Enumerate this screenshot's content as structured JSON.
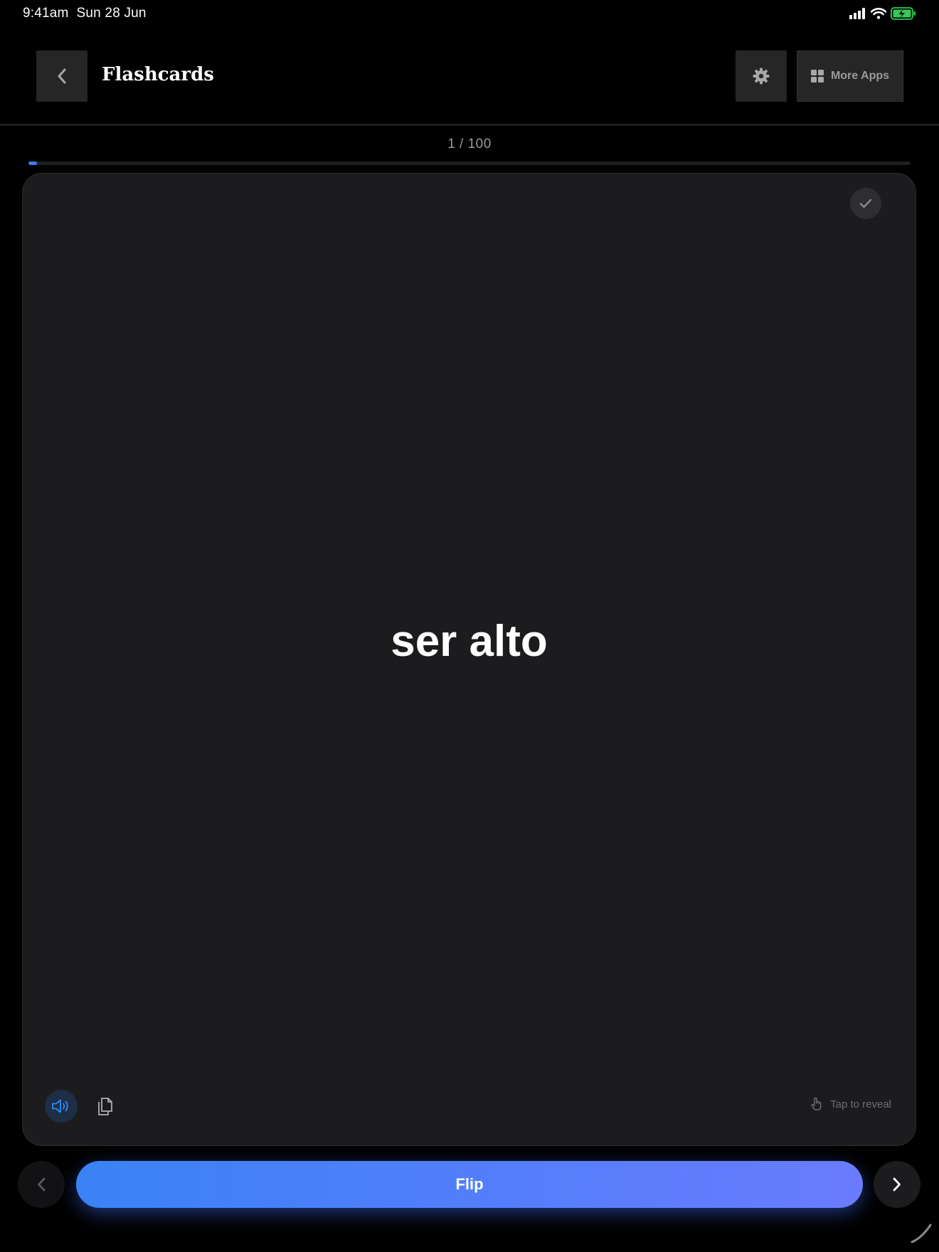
{
  "status_bar": {
    "time": "9:41am",
    "date": "Sun 28 Jun"
  },
  "header": {
    "title": "Flashcards",
    "more_apps_label": "More Apps"
  },
  "progress": {
    "current": 1,
    "total": 100,
    "label": "1 / 100",
    "fraction": 0.01
  },
  "card": {
    "term": "ser alto",
    "hint": "Tap to reveal"
  },
  "controls": {
    "flip_label": "Flip"
  },
  "icons": {
    "back": "chevron-left-icon",
    "settings": "gear-icon",
    "more_apps": "grid-icon",
    "known": "checkmark-icon",
    "speak": "speaker-icon",
    "copy": "copy-icon",
    "tap": "tap-hand-icon",
    "prev": "chevron-left-icon",
    "next": "chevron-right-icon"
  },
  "colors": {
    "background": "#000000",
    "card": "#1c1c1e",
    "accent": "#3b7cf4",
    "flip_gradient_start": "#3a82f6",
    "flip_gradient_end": "#6a7bff",
    "battery": "#34c759"
  }
}
